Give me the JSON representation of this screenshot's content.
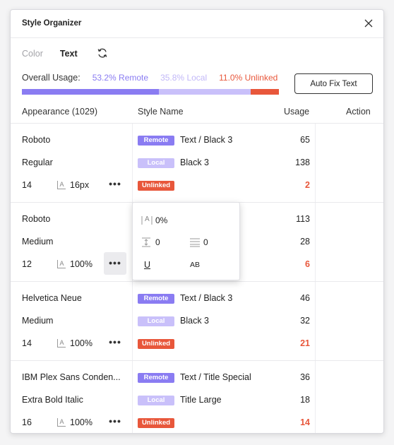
{
  "window": {
    "title": "Style Organizer"
  },
  "tabs": [
    {
      "label": "Color",
      "active": false
    },
    {
      "label": "Text",
      "active": true
    }
  ],
  "usage": {
    "label": "Overall Usage:",
    "remote": "53.2% Remote",
    "local": "35.8% Local",
    "unlinked": "11.0% Unlinked",
    "fractions": {
      "remote": 0.532,
      "local": 0.358,
      "unlinked": 0.11
    }
  },
  "autofix_label": "Auto Fix Text",
  "columns": {
    "appearance": "Appearance (1029)",
    "style_name": "Style Name",
    "usage": "Usage",
    "action": "Action"
  },
  "badges": {
    "remote": "Remote",
    "local": "Local",
    "unlinked": "Unlinked"
  },
  "groups": [
    {
      "font": "Roboto",
      "weight": "Regular",
      "size": "14",
      "size_icon": "A",
      "line_height": "16px",
      "remote_style": "Text / Black 3",
      "local_style": "Black 3",
      "remote_usage": "65",
      "local_usage": "138",
      "unlinked_usage": "2"
    },
    {
      "font": "Roboto",
      "weight": "Medium",
      "size": "12",
      "size_icon": "A",
      "line_height": "100%",
      "remote_style": "",
      "local_style": "",
      "remote_usage": "113",
      "local_usage": "28",
      "unlinked_usage": "6"
    },
    {
      "font": "Helvetica Neue",
      "weight": "Medium",
      "size": "14",
      "size_icon": "A",
      "line_height": "100%",
      "remote_style": "Text / Black 3",
      "local_style": "Black 3",
      "remote_usage": "46",
      "local_usage": "32",
      "unlinked_usage": "21"
    },
    {
      "font": "IBM Plex Sans Conden...",
      "weight": "Extra Bold Italic",
      "size": "16",
      "size_icon": "A",
      "line_height": "100%",
      "remote_style": "Text / Title Special",
      "local_style": "Title Large",
      "remote_usage": "36",
      "local_usage": "18",
      "unlinked_usage": "14"
    }
  ],
  "more_dots": "•••",
  "popover": {
    "letter_icon": "A",
    "letter_spacing": "0%",
    "paragraph_spacing": "0",
    "paragraph_indent": "0",
    "underline": "U",
    "case": "AB"
  },
  "colors": {
    "remote": "#8a7cf2",
    "local": "#c9c0fa",
    "unlinked": "#e8573b"
  },
  "icons": {
    "close": "close-icon",
    "refresh": "refresh-icon",
    "more": "more-horizontal-icon"
  }
}
